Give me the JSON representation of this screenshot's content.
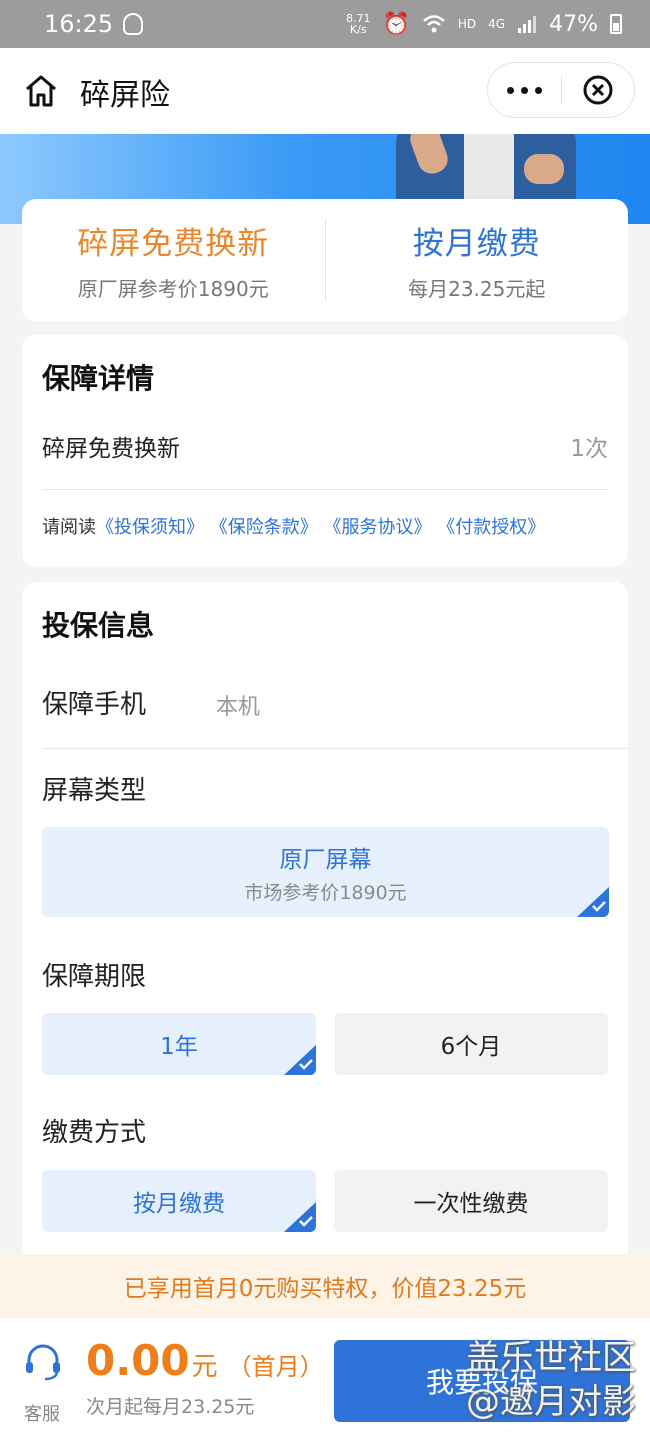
{
  "status_bar": {
    "time": "16:25",
    "net_speed": "8.71",
    "net_unit": "K/s",
    "hd": "HD",
    "network": "4G",
    "battery": "47%"
  },
  "nav": {
    "title": "碎屏险"
  },
  "offer": {
    "left_title": "碎屏免费换新",
    "left_sub": "原厂屏参考价1890元",
    "right_title": "按月缴费",
    "right_sub": "每月23.25元起"
  },
  "detail": {
    "title": "保障详情",
    "row_label": "碎屏免费换新",
    "row_value": "1次",
    "links_prefix": "请阅读",
    "links": [
      "《投保须知》",
      "《保险条款》",
      "《服务协议》",
      "《付款授权》"
    ]
  },
  "info": {
    "title": "投保信息",
    "phone_label": "保障手机",
    "phone_value": "本机",
    "screen_label": "屏幕类型",
    "screen_option_main": "原厂屏幕",
    "screen_option_sub": "市场参考价1890元",
    "term_label": "保障期限",
    "term_options": [
      "1年",
      "6个月"
    ],
    "pay_label": "缴费方式",
    "pay_options": [
      "按月缴费",
      "一次性缴费"
    ]
  },
  "notice": "已享用首月0元购买特权，价值23.25元",
  "bottom": {
    "service_label": "客服",
    "price": "0.00",
    "unit": "元",
    "first_month": "（首月）",
    "next_month": "次月起每月23.25元",
    "buy_label": "我要投保"
  },
  "watermark": {
    "line1": "盖乐世社区",
    "line2": "@邀月对影"
  },
  "colors": {
    "accent_blue": "#2e73d8",
    "accent_orange": "#e8872e",
    "selected_bg": "#e6f0fd"
  }
}
